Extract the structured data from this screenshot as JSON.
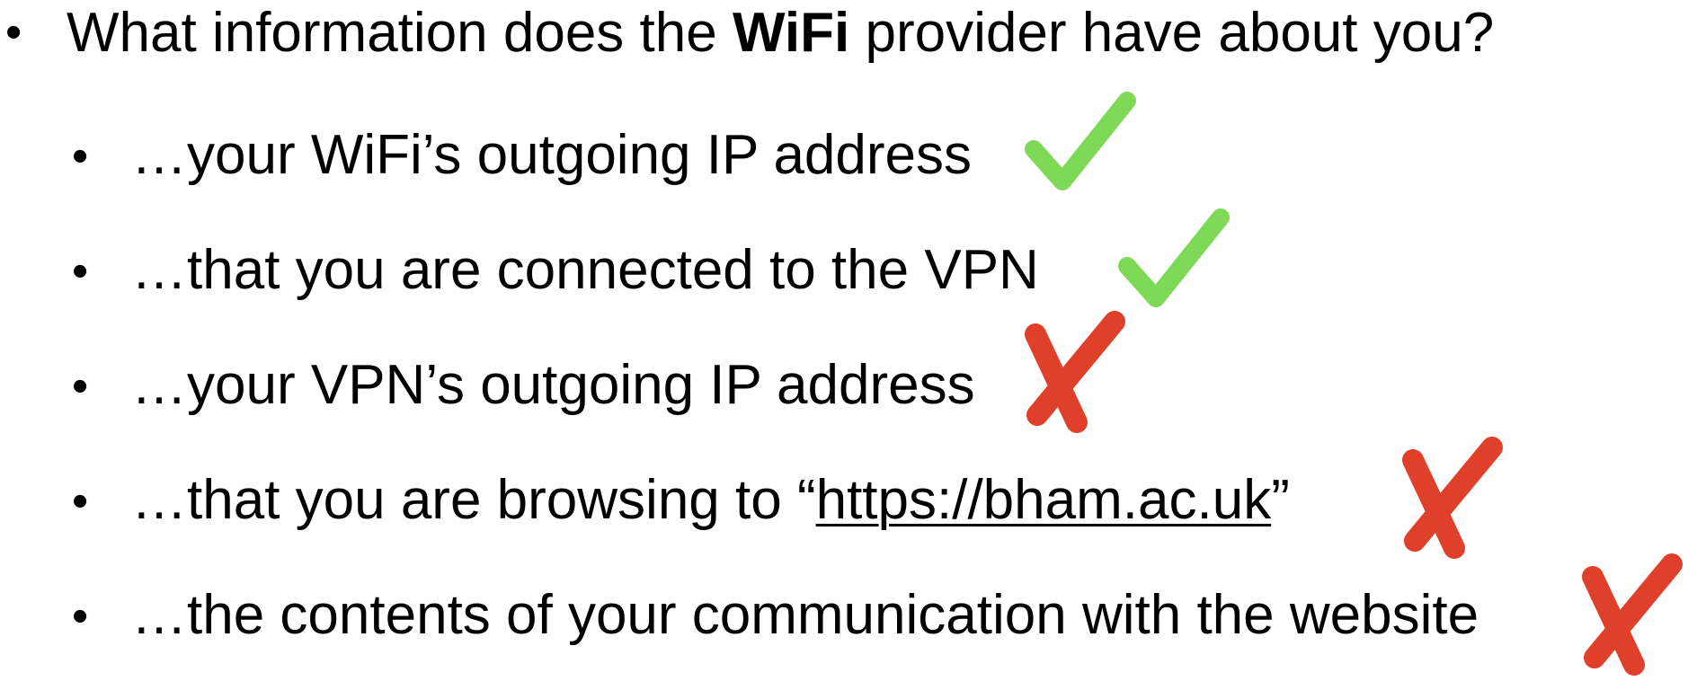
{
  "question": {
    "prefix": "What information does the ",
    "bold": "WiFi",
    "suffix": " provider have about you?"
  },
  "items": [
    {
      "text": "…your WiFi’s outgoing IP address",
      "mark": "check"
    },
    {
      "text": "…that you are connected to the VPN",
      "mark": "check"
    },
    {
      "text": "…your VPN’s outgoing IP address",
      "mark": "cross"
    },
    {
      "text_prefix": "…that you are browsing to “",
      "link": "https://bham.ac.uk",
      "text_suffix": "”",
      "mark": "cross"
    },
    {
      "text": "…the contents of your communication with the website",
      "mark": "cross"
    }
  ],
  "bullet_char": "•",
  "colors": {
    "check": "#7ed957",
    "cross": "#e0402a",
    "text": "#000000"
  }
}
